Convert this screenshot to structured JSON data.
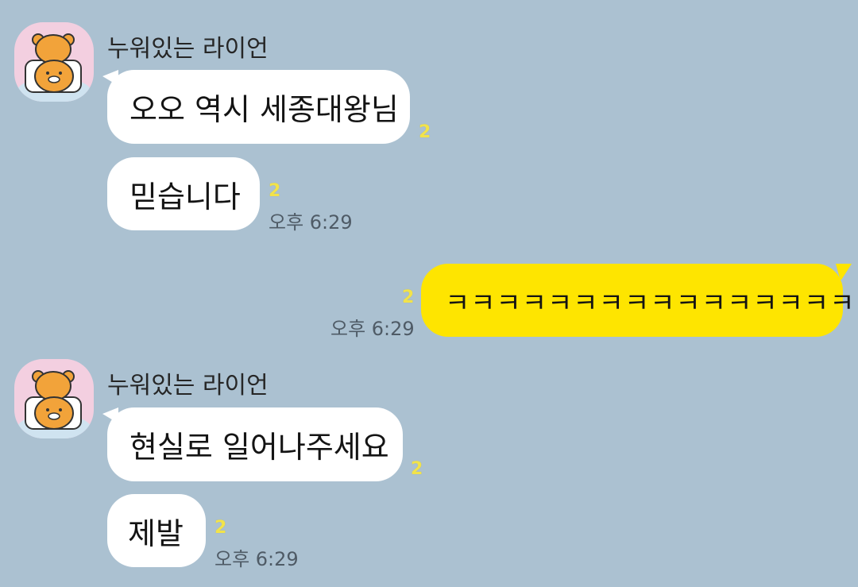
{
  "colors": {
    "background": "#abc1d1",
    "incoming_bubble": "#ffffff",
    "outgoing_bubble": "#fee500",
    "unread_badge": "#f2e34a",
    "avatar_bg": "#f3cfe0"
  },
  "groups": [
    {
      "sender_name": "누워있는 라이언",
      "avatar_icon": "ryan-lying-icon",
      "messages": [
        {
          "text": "오오 역시 세종대왕님",
          "unread": "2",
          "time": ""
        },
        {
          "text": "믿습니다",
          "unread": "2",
          "time": "오후 6:29"
        }
      ]
    },
    {
      "outgoing": true,
      "messages": [
        {
          "text": "ㅋㅋㅋㅋㅋㅋㅋㅋㅋㅋㅋㅋㅋㅋㅋㅋ",
          "unread": "2",
          "time": "오후 6:29"
        }
      ]
    },
    {
      "sender_name": "누워있는 라이언",
      "avatar_icon": "ryan-lying-icon",
      "messages": [
        {
          "text": "현실로 일어나주세요",
          "unread": "2",
          "time": ""
        },
        {
          "text": "제발",
          "unread": "2",
          "time": "오후 6:29"
        }
      ]
    }
  ]
}
